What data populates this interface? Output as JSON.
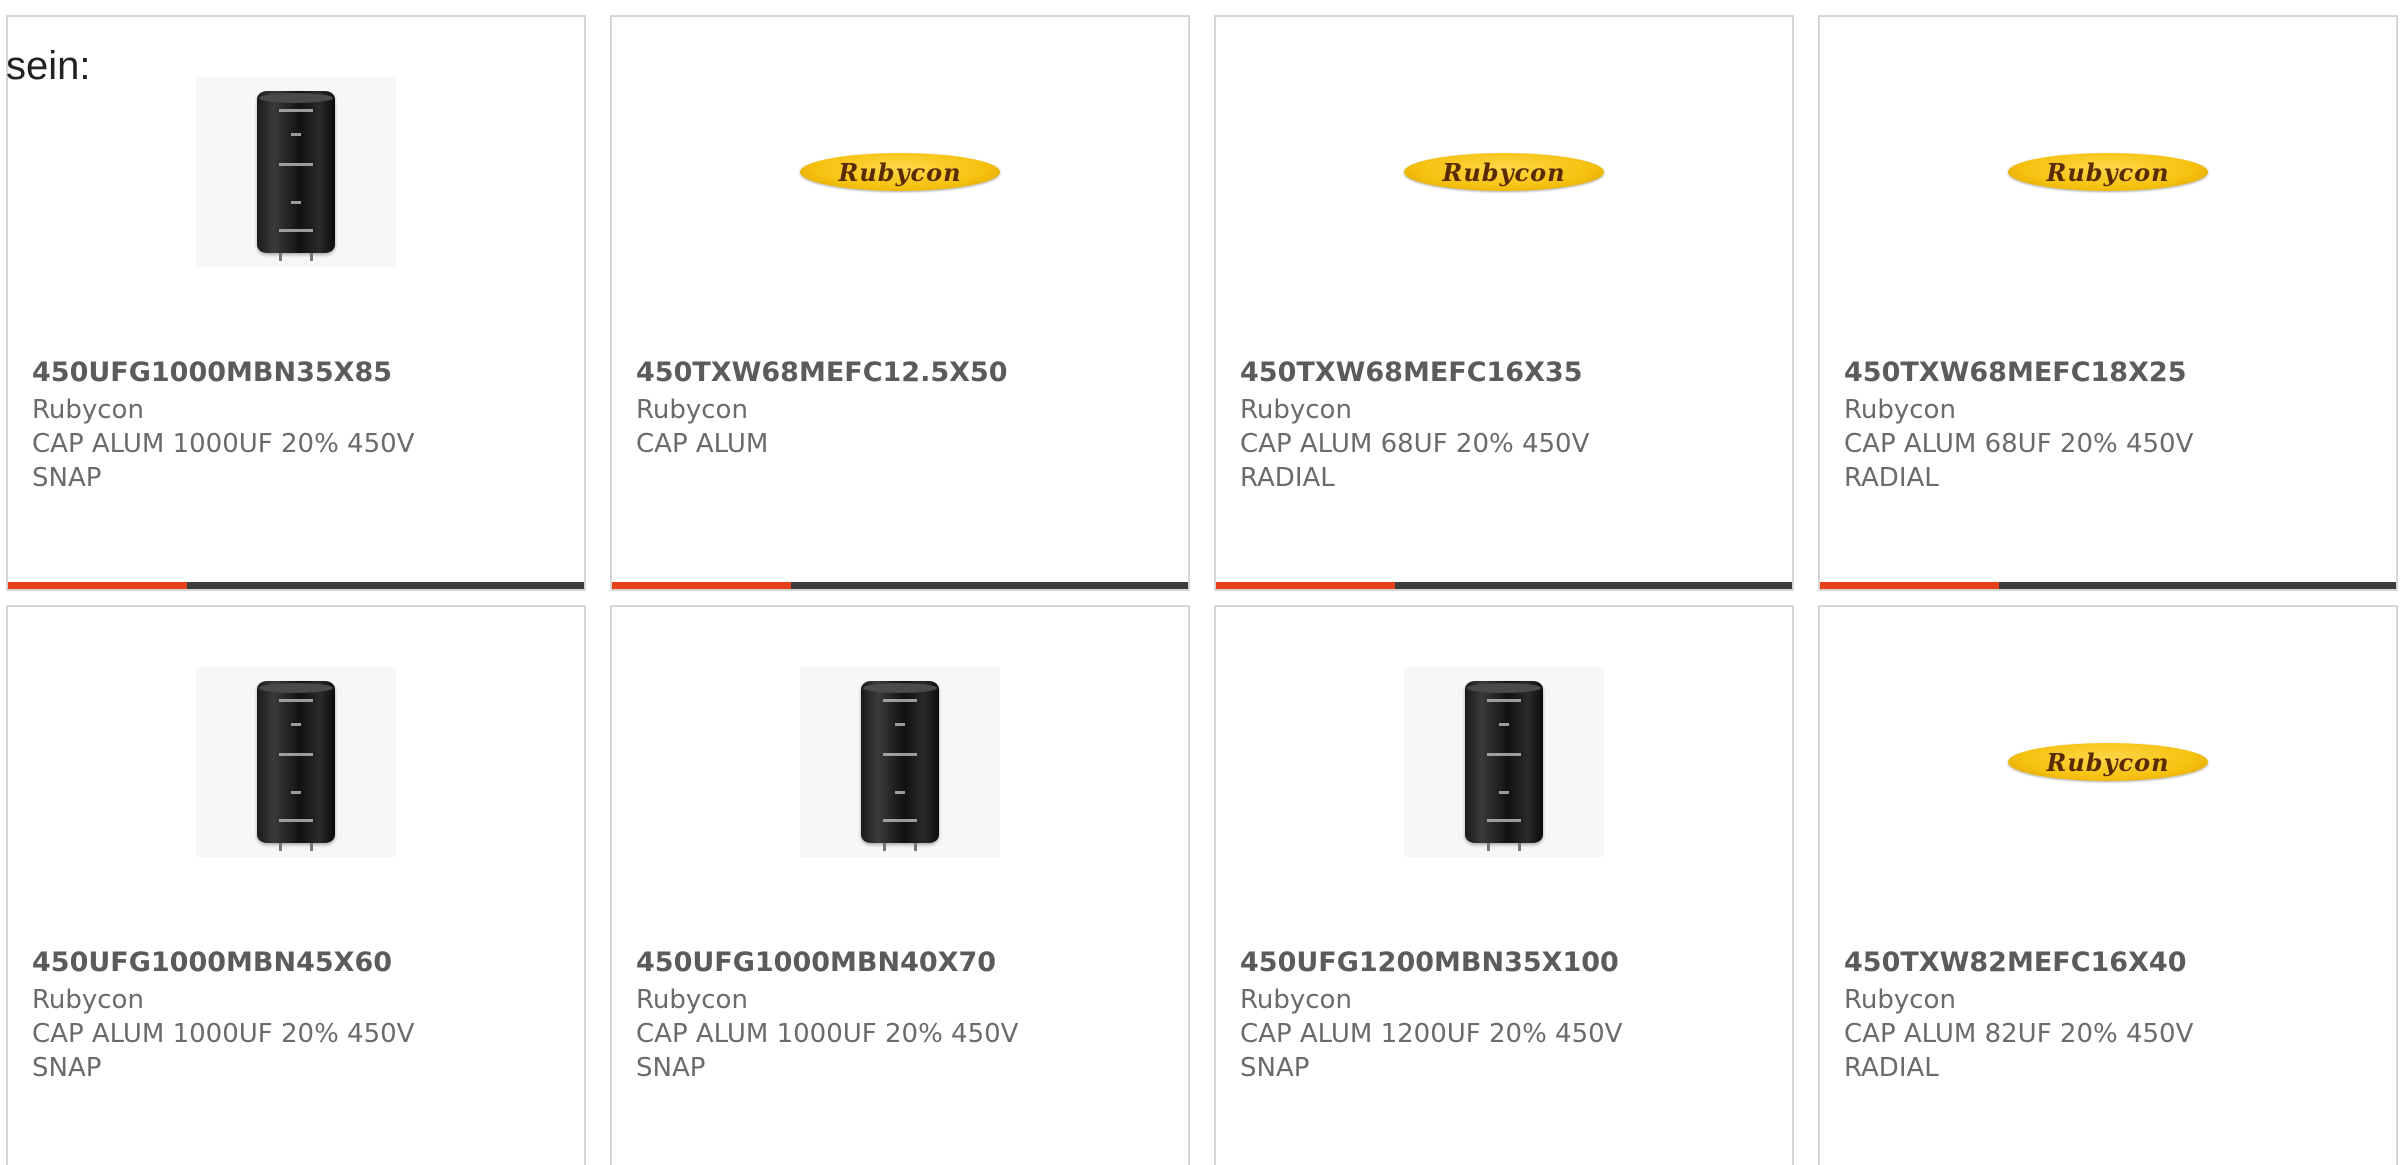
{
  "intro_text": "sein:",
  "colors": {
    "accent": "#e8401a",
    "bar_track": "#3c3c3c",
    "card_border": "#d6d6d6",
    "logo_yellow": "#f6c10f"
  },
  "products": [
    {
      "part": "450UFG1000MBN35X85",
      "brand": "Rubycon",
      "desc1": "CAP ALUM 1000UF 20% 450V",
      "desc2": "SNAP",
      "image": "capacitor",
      "progress": 0.31
    },
    {
      "part": "450TXW68MEFC12.5X50",
      "brand": "Rubycon",
      "desc1": "CAP ALUM",
      "desc2": "",
      "image": "rubycon-logo",
      "progress": 0.31
    },
    {
      "part": "450TXW68MEFC16X35",
      "brand": "Rubycon",
      "desc1": "CAP ALUM 68UF 20% 450V",
      "desc2": "RADIAL",
      "image": "rubycon-logo",
      "progress": 0.31
    },
    {
      "part": "450TXW68MEFC18X25",
      "brand": "Rubycon",
      "desc1": "CAP ALUM 68UF 20% 450V",
      "desc2": "RADIAL",
      "image": "rubycon-logo",
      "progress": 0.31
    },
    {
      "part": "450UFG1000MBN45X60",
      "brand": "Rubycon",
      "desc1": "CAP ALUM 1000UF 20% 450V",
      "desc2": "SNAP",
      "image": "capacitor"
    },
    {
      "part": "450UFG1000MBN40X70",
      "brand": "Rubycon",
      "desc1": "CAP ALUM 1000UF 20% 450V",
      "desc2": "SNAP",
      "image": "capacitor"
    },
    {
      "part": "450UFG1200MBN35X100",
      "brand": "Rubycon",
      "desc1": "CAP ALUM 1200UF 20% 450V",
      "desc2": "SNAP",
      "image": "capacitor"
    },
    {
      "part": "450TXW82MEFC16X40",
      "brand": "Rubycon",
      "desc1": "CAP ALUM 82UF 20% 450V",
      "desc2": "RADIAL",
      "image": "rubycon-logo"
    }
  ],
  "logo_text": "Rubycon"
}
